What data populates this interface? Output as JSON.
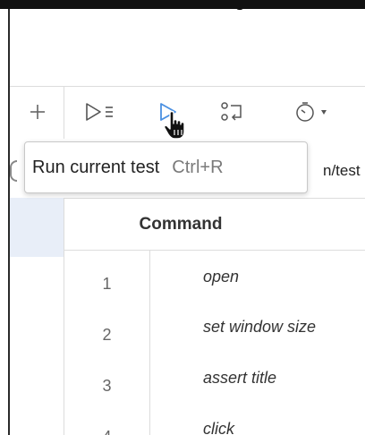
{
  "toolbar": {
    "add_icon": "plus-icon",
    "buttons": [
      {
        "icon": "run-all-tests-icon"
      },
      {
        "icon": "run-current-test-icon"
      },
      {
        "icon": "step-over-icon"
      },
      {
        "icon": "test-speed-icon"
      }
    ]
  },
  "url_fragment": "n/test",
  "tooltip": {
    "label": "Run current test",
    "shortcut": "Ctrl+R"
  },
  "table": {
    "header_command": "Command",
    "rows": [
      {
        "num": "1",
        "command": "open"
      },
      {
        "num": "2",
        "command": "set window size"
      },
      {
        "num": "3",
        "command": "assert title"
      },
      {
        "num": "4",
        "command": "click"
      }
    ]
  },
  "colors": {
    "accent_blue": "#4a90e2",
    "selected_row_bg": "#e8eef8",
    "divider": "#dcdcdc"
  }
}
